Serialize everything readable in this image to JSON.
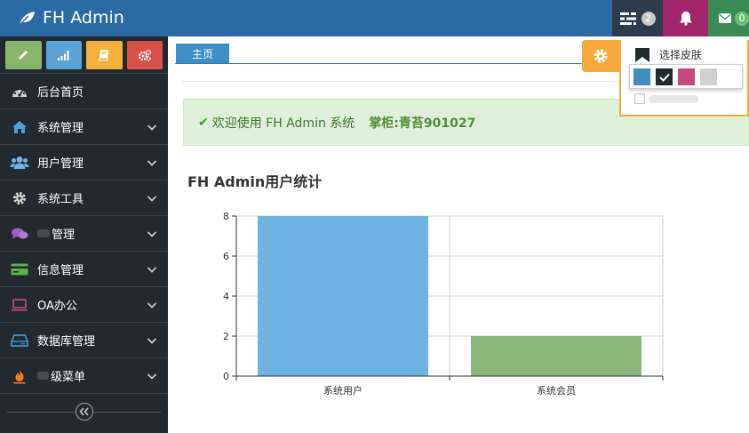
{
  "header": {
    "brand": "FH Admin",
    "tasks_badge": "2",
    "mail_badge": "0",
    "colors": {
      "bar": "#2b6aa5",
      "tasks": "#2e3b4a",
      "bell": "#a0256a",
      "mail": "#3b8a53"
    }
  },
  "sidebar": {
    "shortcuts": [
      {
        "icon": "pencil-icon",
        "color": "#86b56b"
      },
      {
        "icon": "signal-icon",
        "color": "#5ba3d4"
      },
      {
        "icon": "book-icon",
        "color": "#f2b13d"
      },
      {
        "icon": "cogs-icon",
        "color": "#d65149"
      }
    ],
    "items": [
      {
        "label": "后台首页",
        "icon": "dashboard-icon",
        "has_children": false
      },
      {
        "label": "系统管理",
        "icon": "home-icon",
        "has_children": true
      },
      {
        "label": "用户管理",
        "icon": "users-icon",
        "has_children": true
      },
      {
        "label": "系统工具",
        "icon": "gear-icon",
        "has_children": true
      },
      {
        "label": "管理",
        "icon": "chat-icon",
        "has_children": true
      },
      {
        "label": "信息管理",
        "icon": "credit-card-icon",
        "has_children": true
      },
      {
        "label": "OA办公",
        "icon": "laptop-icon",
        "has_children": true
      },
      {
        "label": "数据库管理",
        "icon": "hdd-icon",
        "has_children": true
      },
      {
        "label": "级菜单",
        "icon": "fire-icon",
        "has_children": true
      }
    ]
  },
  "tabs": [
    {
      "label": "主页"
    }
  ],
  "alert": {
    "text": "欢迎使用 FH Admin 系统",
    "owner": "掌柜:青苔901027"
  },
  "chart_heading": "FH Admin用户统计",
  "skin": {
    "label": "选择皮肤",
    "swatches": [
      "#438eb9",
      "#222a2d",
      "#c6487e",
      "#d0d0d0"
    ],
    "selected": 1
  },
  "chart_data": {
    "type": "bar",
    "categories": [
      "系统用户",
      "系统会员"
    ],
    "values": [
      8,
      2
    ],
    "colors": [
      "#6db3e3",
      "#8ab87d"
    ],
    "ylim": [
      0,
      8
    ],
    "yticks": [
      "0",
      "2",
      "4",
      "6",
      "8"
    ],
    "grid": true
  }
}
